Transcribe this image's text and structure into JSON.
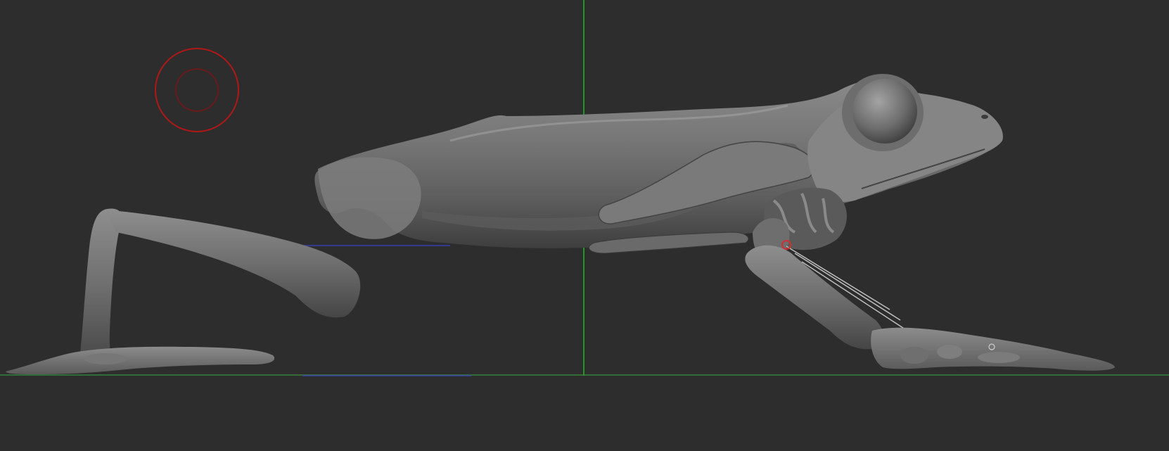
{
  "viewport": {
    "background": "#2d2d2d",
    "grid": {
      "vertical_axis_color": "#1fb81f",
      "horizontal_axis_color": "#3f8e3f",
      "depth_axis_color": "#3a3fae"
    },
    "brush_cursor": {
      "icon": "brush-cursor-icon",
      "outer_color": "#b01818",
      "inner_color": "#6a1a1a"
    },
    "model": {
      "icon": "frog-mesh",
      "base_color": "#7f7f7f",
      "shadow_color": "#3b3b3b",
      "highlight_color": "#b6b6b6"
    },
    "rig": {
      "joint_marker_color": "#d23030",
      "bone_color": "#bdbdbd"
    }
  }
}
